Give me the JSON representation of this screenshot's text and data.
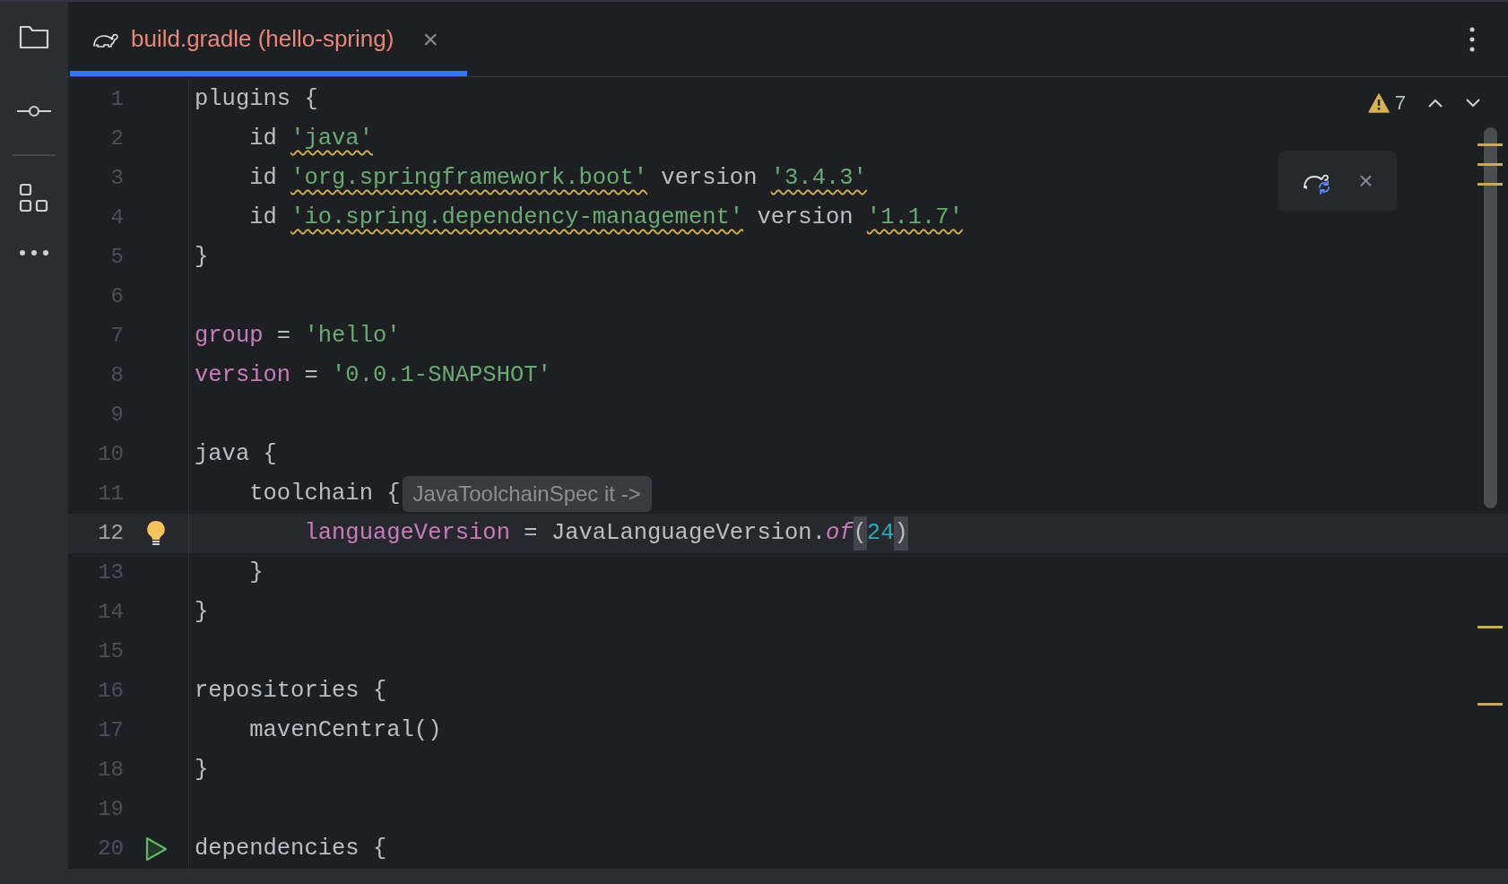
{
  "tab": {
    "label": "build.gradle (hello-spring)",
    "selected": true,
    "close": "×"
  },
  "inspections": {
    "warnings": "7"
  },
  "lines": [
    {
      "number": "1",
      "kind": "code",
      "current": false,
      "tokens": [
        {
          "text": "plugins {",
          "kind": "plain"
        }
      ]
    },
    {
      "number": "2",
      "kind": "code",
      "current": false,
      "tokens": [
        {
          "text": "    id ",
          "kind": "plain"
        },
        {
          "text": "'java'",
          "kind": "string",
          "warning": true
        }
      ]
    },
    {
      "number": "3",
      "kind": "code",
      "current": false,
      "tokens": [
        {
          "text": "    id ",
          "kind": "plain"
        },
        {
          "text": "'org.springframework.boot'",
          "kind": "string",
          "warning": true
        },
        {
          "text": " version ",
          "kind": "plain"
        },
        {
          "text": "'3.4.3'",
          "kind": "string",
          "warning": true
        }
      ]
    },
    {
      "number": "4",
      "kind": "code",
      "current": false,
      "tokens": [
        {
          "text": "    id ",
          "kind": "plain"
        },
        {
          "text": "'io.spring.dependency-management'",
          "kind": "string",
          "warning": true
        },
        {
          "text": " version ",
          "kind": "plain"
        },
        {
          "text": "'1.1.7'",
          "kind": "string",
          "warning": true
        }
      ]
    },
    {
      "number": "5",
      "kind": "code",
      "current": false,
      "tokens": [
        {
          "text": "}",
          "kind": "plain"
        }
      ]
    },
    {
      "number": "6",
      "kind": "code",
      "current": false
    },
    {
      "number": "7",
      "kind": "code",
      "current": false,
      "tokens": [
        {
          "text": "group",
          "kind": "property"
        },
        {
          "text": " = ",
          "kind": "plain"
        },
        {
          "text": "'hello'",
          "kind": "string"
        }
      ]
    },
    {
      "number": "8",
      "kind": "code",
      "current": false,
      "tokens": [
        {
          "text": "version",
          "kind": "property"
        },
        {
          "text": " = ",
          "kind": "plain"
        },
        {
          "text": "'0.0.1-SNAPSHOT'",
          "kind": "string"
        }
      ]
    },
    {
      "number": "9",
      "kind": "code",
      "current": false
    },
    {
      "number": "10",
      "kind": "code",
      "current": false,
      "tokens": [
        {
          "text": "java {",
          "kind": "plain"
        }
      ]
    },
    {
      "number": "11",
      "kind": "code",
      "current": false,
      "tokens": [
        {
          "text": "    toolchain {",
          "kind": "plain"
        }
      ],
      "hint": "JavaToolchainSpec it ->"
    },
    {
      "number": "12",
      "kind": "bulb",
      "current": true,
      "tokens": [
        {
          "text": "        languageVersion",
          "kind": "property"
        },
        {
          "text": " = JavaLanguageVersion.",
          "kind": "plain"
        },
        {
          "text": "of",
          "kind": "method"
        },
        {
          "text": "(",
          "kind": "plain",
          "matched": true
        },
        {
          "text": "24",
          "kind": "number"
        },
        {
          "text": ")",
          "kind": "plain",
          "matched": true
        }
      ]
    },
    {
      "number": "13",
      "kind": "code",
      "current": false,
      "tokens": [
        {
          "text": "    }",
          "kind": "plain"
        }
      ]
    },
    {
      "number": "14",
      "kind": "code",
      "current": false,
      "tokens": [
        {
          "text": "}",
          "kind": "plain"
        }
      ]
    },
    {
      "number": "15",
      "kind": "code",
      "current": false
    },
    {
      "number": "16",
      "kind": "code",
      "current": false,
      "tokens": [
        {
          "text": "repositories {",
          "kind": "plain"
        }
      ]
    },
    {
      "number": "17",
      "kind": "code",
      "current": false,
      "tokens": [
        {
          "text": "    mavenCentral()",
          "kind": "plain"
        }
      ]
    },
    {
      "number": "18",
      "kind": "code",
      "current": false,
      "tokens": [
        {
          "text": "}",
          "kind": "plain"
        }
      ]
    },
    {
      "number": "19",
      "kind": "code",
      "current": false
    },
    {
      "number": "20",
      "kind": "run",
      "current": false,
      "tokens": [
        {
          "text": "dependencies {",
          "kind": "plain"
        }
      ]
    }
  ]
}
